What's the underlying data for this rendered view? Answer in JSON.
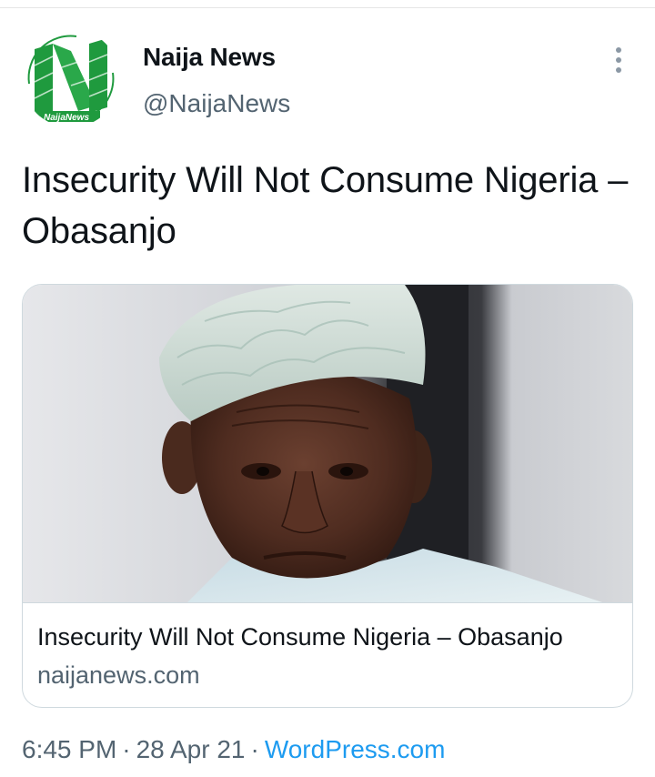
{
  "tweet": {
    "author": {
      "name": "Naija News",
      "handle": "@NaijaNews",
      "avatar_text": "NaijaNews"
    },
    "text": "Insecurity Will Not Consume Nigeria – Obasanjo",
    "card": {
      "title": "Insecurity Will Not Consume Nigeria – Obasanjo",
      "domain": "naijanews.com"
    },
    "time": "6:45 PM",
    "date": "28 Apr 21",
    "separator": "·",
    "source": "WordPress.com"
  },
  "icons": {
    "more": "more-vertical-icon"
  },
  "colors": {
    "text_primary": "#0f1419",
    "text_secondary": "#536471",
    "link": "#1d9bf0",
    "border": "#cfd9de",
    "logo_green": "#1f9a3e"
  }
}
